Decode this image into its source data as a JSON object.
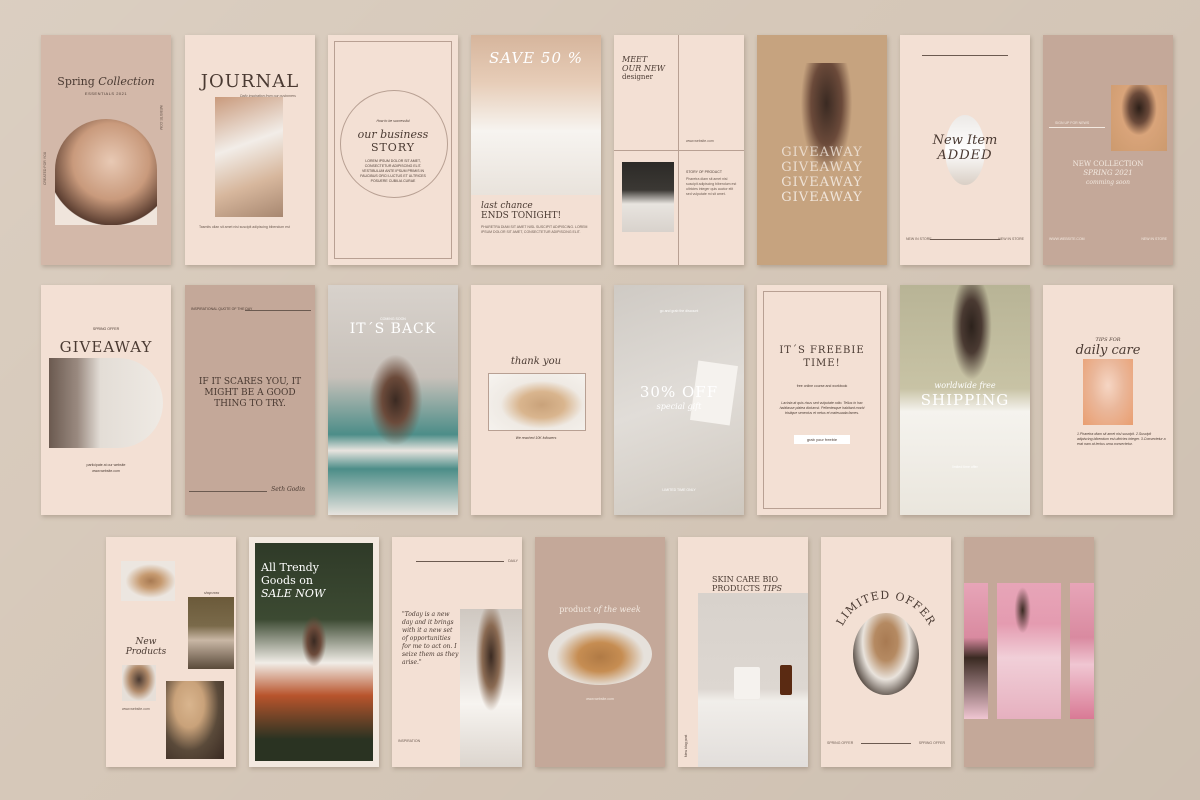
{
  "colors": {
    "background": "#d6c8b9",
    "blush": "#f3e0d4",
    "taupe": "#c4a899",
    "beige": "#c6a37f",
    "ink": "#4a3a32"
  },
  "cards": {
    "c1": {
      "title_a": "Spring",
      "title_b": "Collection",
      "subtitle": "ESSENTIALS 2021",
      "side": "CREATED FOR YOU",
      "side2": "WEBSITE.COM"
    },
    "c2": {
      "title": "JOURNAL",
      "subtitle": "Daily inspiration from our customers",
      "body": "Tasmits ollan sit amet nisi suscipit adipiscing bibendum est"
    },
    "c3": {
      "small": "How to be successful",
      "title_a": "our business",
      "title_b": "STORY",
      "body": "LOREM IPSUM DOLOR SIT AMET, CONSECTETUR ADIPISCING ELIT. VESTIBULUM ANTE IPSUM PRIMIS IN FAUCIBUS ORCI LUCTUS ET ULTRICES POSUERE CUBILIA CURAE"
    },
    "c4": {
      "title": "SAVE 50 %",
      "line1": "last chance",
      "line2": "ENDS TONIGHT!",
      "body": "PHARETRA DIAM SIT AMET NISL SUSCIPIT ADIPISCING. LOREM IPSUM DOLOR SIT AMET, CONSECTETUR ADIPISCING ELIT."
    },
    "c5": {
      "t1": "MEET",
      "t2": "OUR NEW",
      "t3": "designer",
      "url": "www.website.com",
      "label": "STORY OF PRODUCT",
      "body": "Pharetra diam sit amet nisl suscipit adipiscing bibendum est ultricies integer quis auctor elit sed vulputate mi sit amet."
    },
    "c6": {
      "word": "GIVEAWAY"
    },
    "c7": {
      "t1": "New Item",
      "t2": "ADDED",
      "left": "NEW IN STORE",
      "right": "NEW IN STORE"
    },
    "c8": {
      "signup": "SIGN UP FOR NEWS",
      "t1": "NEW COLLECTION",
      "t2": "SPRING 2021",
      "t3": "comming soon",
      "left": "WWW.WEBSITE.COM",
      "right": "NEW IN STORE"
    },
    "c9": {
      "small": "SPRING OFFER",
      "title": "GIVEAWAY",
      "body": "participate at our website",
      "url": "www.website.com"
    },
    "c10": {
      "small": "INSPIRATIONAL QUOTE OF THE DAY",
      "quote": "IF IT SCARES YOU, IT MIGHT BE A GOOD THING TO TRY.",
      "author": "Seth Godin"
    },
    "c11": {
      "small": "COMING SOON",
      "title": "IT´S BACK"
    },
    "c12": {
      "title": "thank you",
      "body": "We reached 10K followers"
    },
    "c13": {
      "small": "go and grab the discount",
      "t1": "30% OFF",
      "t2": "special gift",
      "bottom": "LIMITED TIME ONLY"
    },
    "c14": {
      "t1": "IT´S FREEBIE",
      "t2": "TIME!",
      "t3": "free online course and workbook",
      "body": "Lacinia at quis risus sed vulputate odio. Tellus in hac habitasse platea dictumst. Pellentesque habitant morbi tristique senectus et netus et malesuada fames.",
      "button": "grab your freebie"
    },
    "c15": {
      "t1": "worldwide free",
      "t2": "SHIPPING",
      "small": "limited time offer"
    },
    "c16": {
      "t1": "TIPS FOR",
      "t2": "daily care",
      "body": "1.Pharetra diam sit amet nisl suscipit. 2.Suscipit adipiscing bibendum est ultricies integer. 3.Consectetur a erat nam at lectus urna consectetur."
    },
    "c17": {
      "small": "shop now",
      "t1": "New",
      "t2": "Products",
      "url": "www.website.com"
    },
    "c18": {
      "t1": "All Trendy",
      "t2": "Goods on",
      "t3": "SALE NOW"
    },
    "c19": {
      "small": "DAILY",
      "quote": "\"Today is a new day and it brings with it a new set of opportunities for me to act on. I seize them as they arise.\"",
      "bottom": "INSPIRATION"
    },
    "c20": {
      "t1": "product",
      "t2": "of the week",
      "url": "www.website.com"
    },
    "c21": {
      "t1": "SKIN CARE BIO",
      "t2": "PRODUCTS",
      "t3": "TIPS",
      "side": "New blog post"
    },
    "c22": {
      "title": "LIMITED OFFER",
      "left": "SPRING OFFER",
      "right": "SPRING OFFER"
    },
    "c23": {}
  }
}
